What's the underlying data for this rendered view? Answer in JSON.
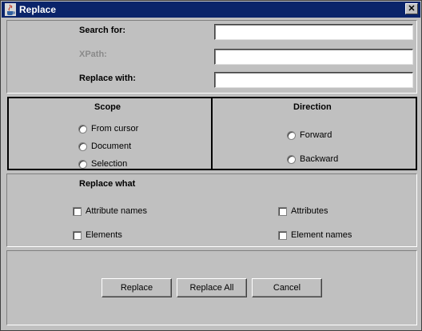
{
  "window": {
    "title": "Replace"
  },
  "search": {
    "search_for_label": "Search for:",
    "search_for_value": "",
    "xpath_label": "XPath:",
    "xpath_value": "",
    "replace_with_label": "Replace with:",
    "replace_with_value": ""
  },
  "scope": {
    "title": "Scope",
    "options": [
      "From cursor",
      "Document",
      "Selection"
    ]
  },
  "direction": {
    "title": "Direction",
    "options": [
      "Forward",
      "Backward"
    ]
  },
  "replace_what": {
    "title": "Replace what",
    "options": [
      "Attribute names",
      "Attributes",
      "Elements",
      "Element names"
    ]
  },
  "buttons": {
    "replace": "Replace",
    "replace_all": "Replace All",
    "cancel": "Cancel"
  },
  "icons": {
    "app": "java-cup-icon",
    "close": "close-icon"
  }
}
